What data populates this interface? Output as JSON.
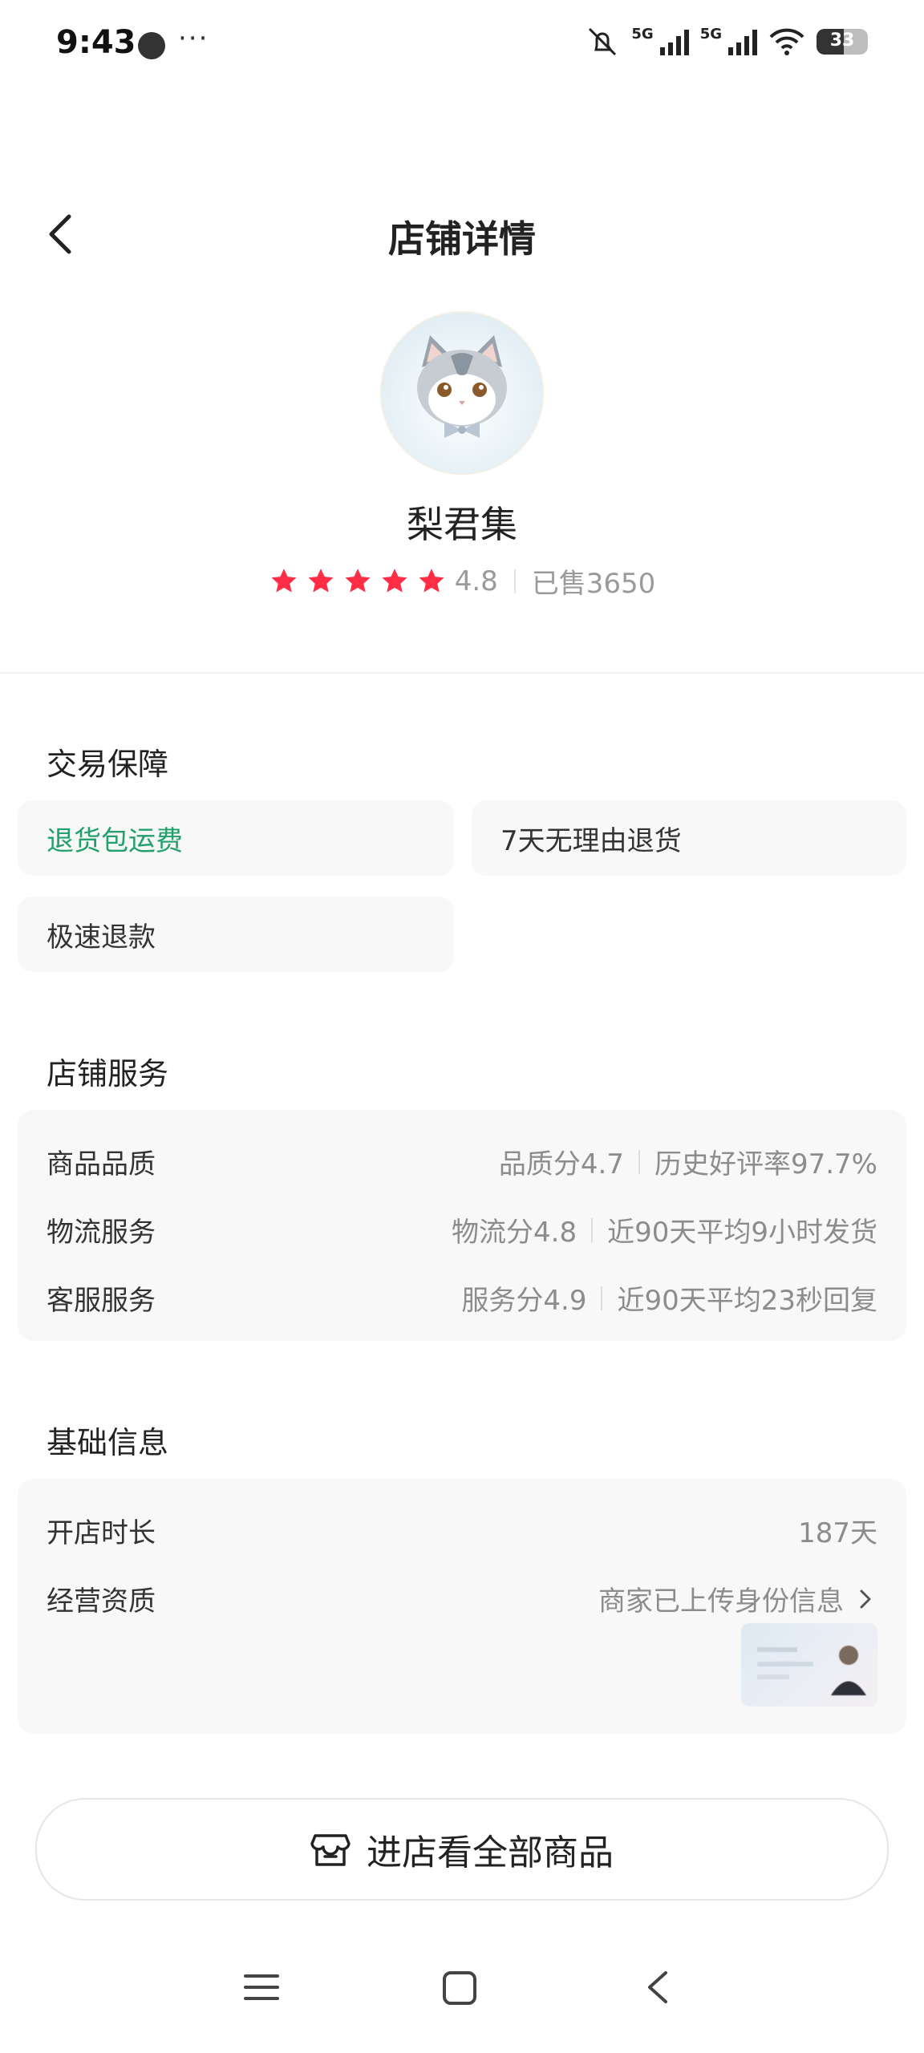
{
  "status_bar": {
    "time": "9:43",
    "dots": "···",
    "network_1": "5G",
    "network_2": "5G",
    "battery": "33"
  },
  "header": {
    "title": "店铺详情",
    "back_icon": "chevron-left-icon"
  },
  "store": {
    "name": "梨君集",
    "rating": "4.8",
    "sold": "已售3650",
    "stars": 5,
    "star_color": "#ff2d46"
  },
  "trade_guarantee": {
    "title": "交易保障",
    "chips": [
      "退货包运费",
      "7天无理由退货",
      "极速退款"
    ],
    "highlight_color": "#22a06b"
  },
  "store_service": {
    "title": "店铺服务",
    "rows": [
      {
        "label": "商品品质",
        "score": "品质分4.7",
        "detail": "历史好评率97.7%"
      },
      {
        "label": "物流服务",
        "score": "物流分4.8",
        "detail": "近90天平均9小时发货"
      },
      {
        "label": "客服服务",
        "score": "服务分4.9",
        "detail": "近90天平均23秒回复"
      }
    ]
  },
  "basic_info": {
    "title": "基础信息",
    "open_label": "开店时长",
    "open_value": "187天",
    "qual_label": "经营资质",
    "qual_value": "商家已上传身份信息"
  },
  "cta": {
    "label": "进店看全部商品",
    "icon": "store-icon"
  },
  "nav": {
    "menu_icon": "menu-icon",
    "home_icon": "home-square-icon",
    "back_icon": "back-triangle-icon"
  }
}
